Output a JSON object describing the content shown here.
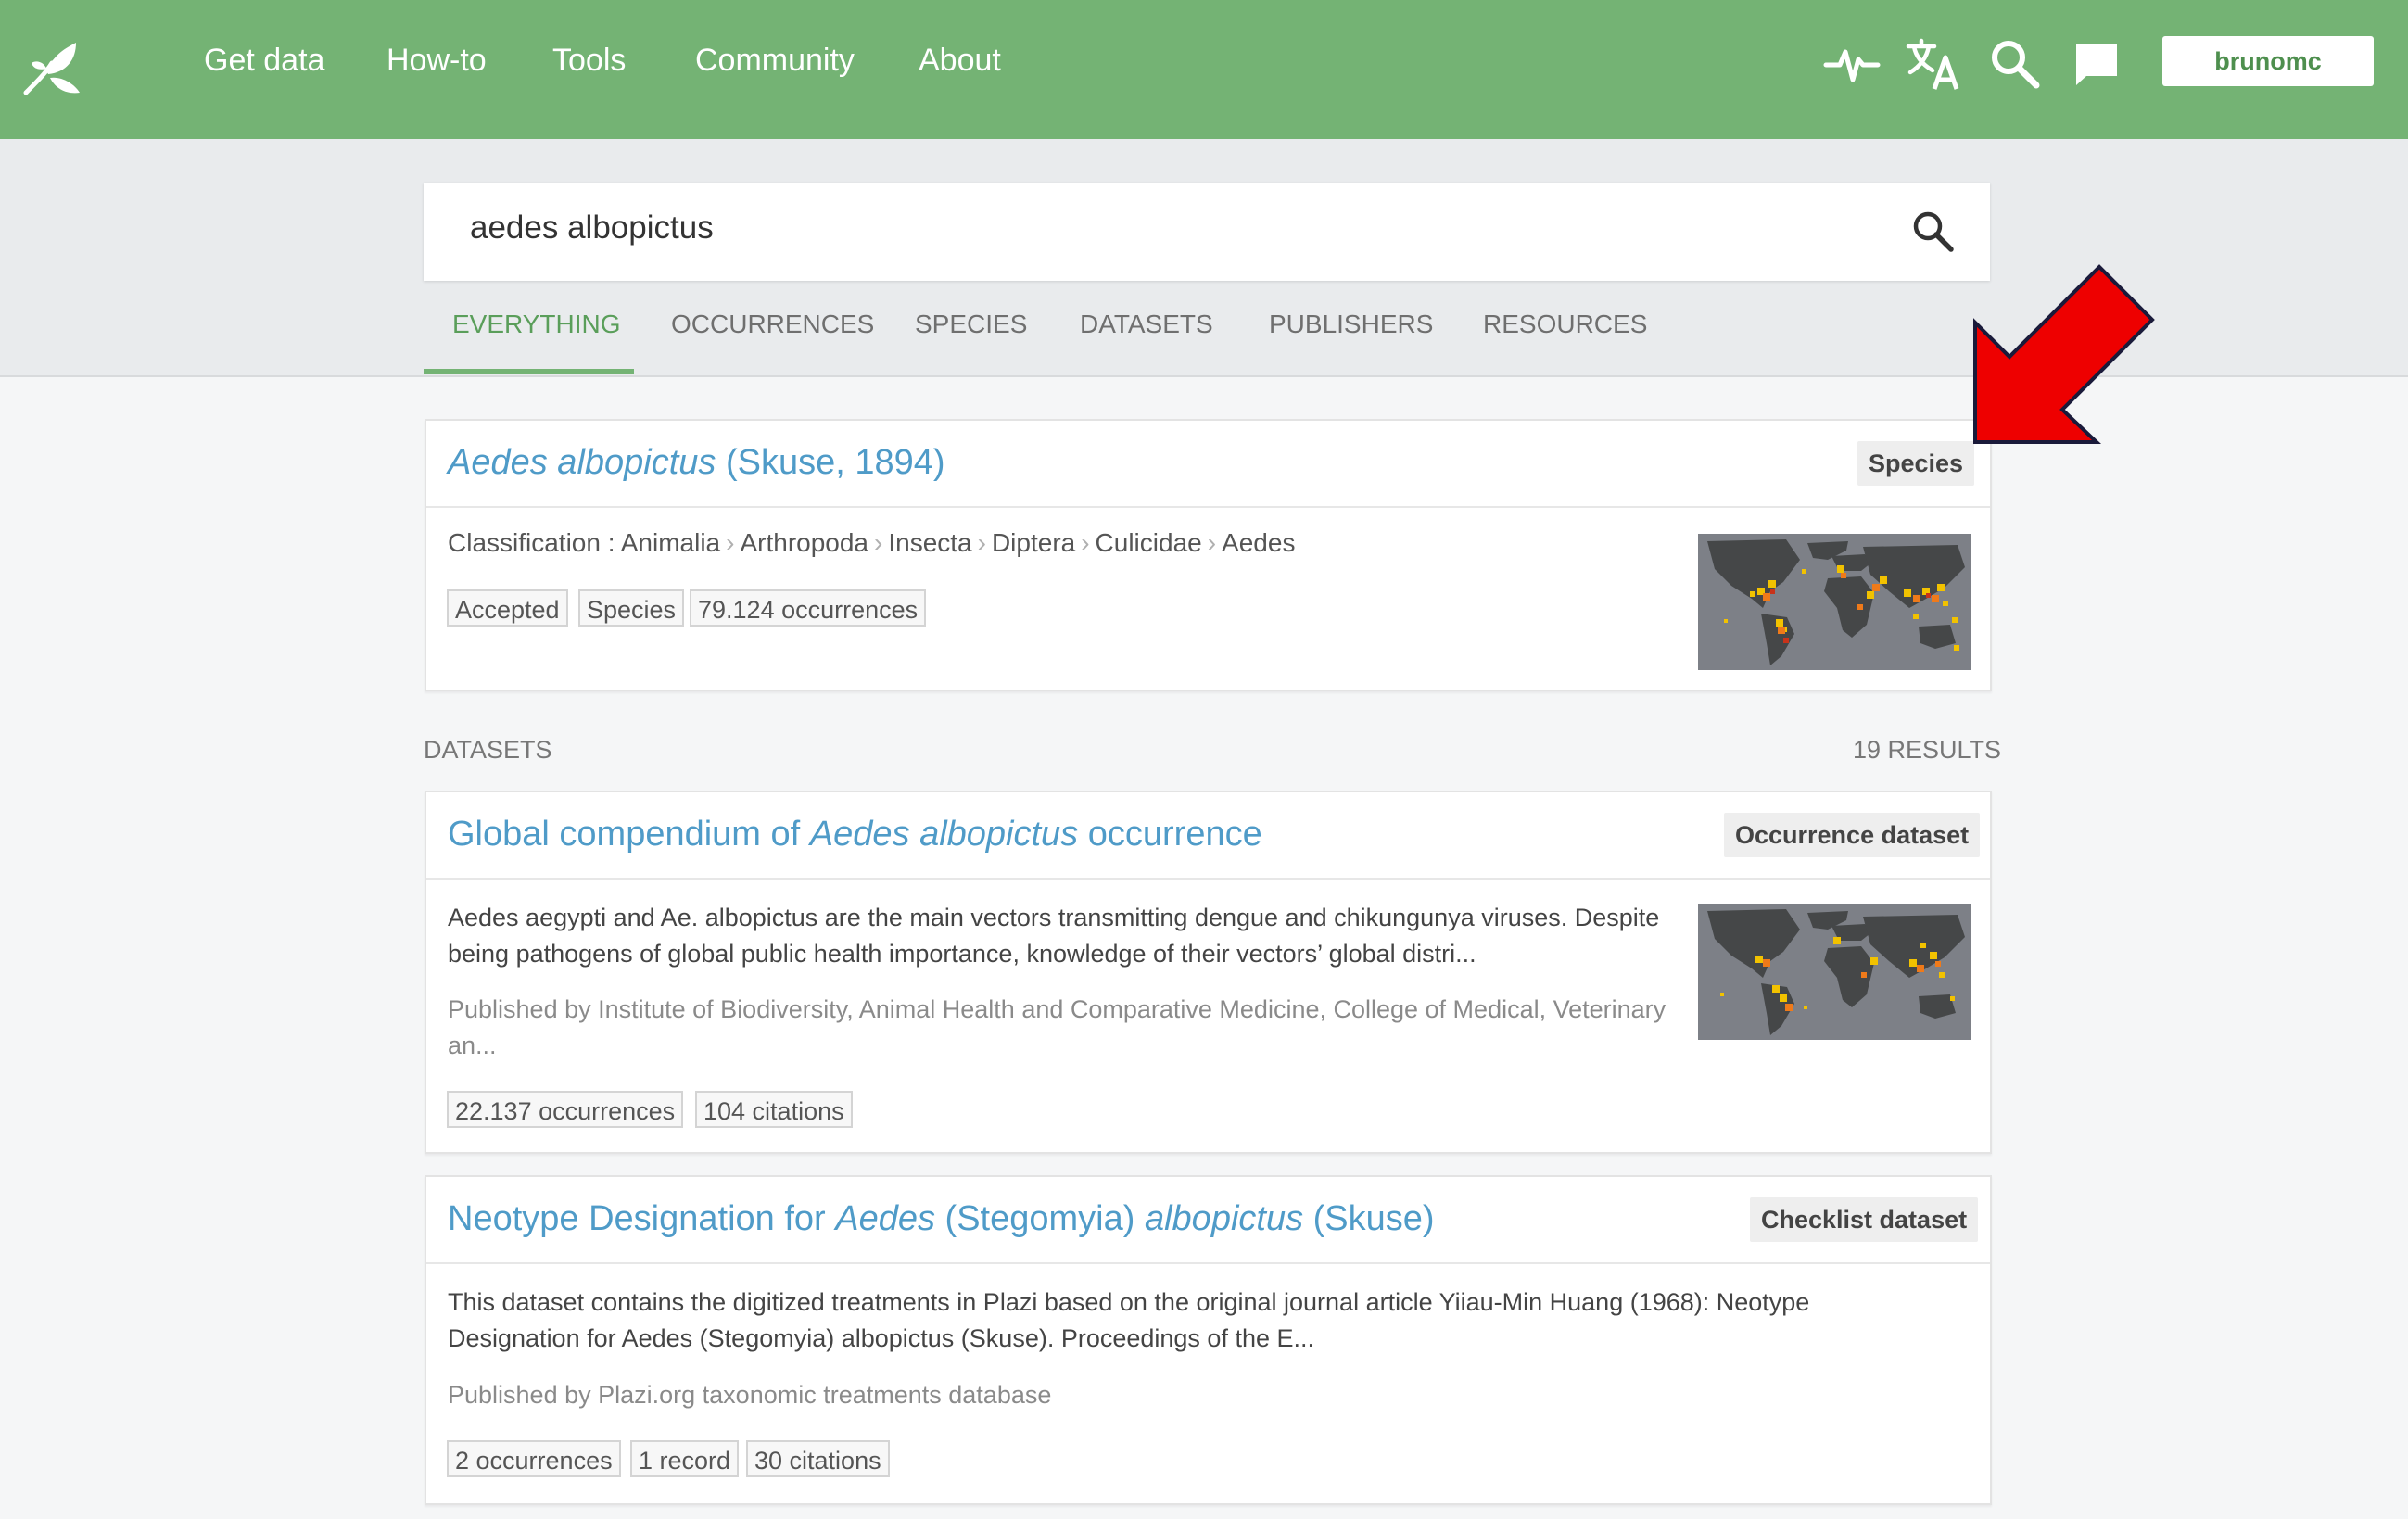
{
  "topbar": {
    "nav": [
      "Get data",
      "How-to",
      "Tools",
      "Community",
      "About"
    ],
    "icons": [
      "activity-icon",
      "translate-icon",
      "search-icon",
      "chat-icon"
    ],
    "user": "brunomc"
  },
  "search": {
    "query": "aedes albopictus"
  },
  "tabs": [
    {
      "label": "EVERYTHING",
      "active": true
    },
    {
      "label": "OCCURRENCES",
      "active": false
    },
    {
      "label": "SPECIES",
      "active": false
    },
    {
      "label": "DATASETS",
      "active": false
    },
    {
      "label": "PUBLISHERS",
      "active": false
    },
    {
      "label": "RESOURCES",
      "active": false
    }
  ],
  "species_card": {
    "title_italic": "Aedes albopictus",
    "title_rest": " (Skuse, 1894)",
    "type": "Species",
    "classification_label": "Classification :",
    "classification": [
      "Animalia",
      "Arthropoda",
      "Insecta",
      "Diptera",
      "Culicidae",
      "Aedes"
    ],
    "chips": [
      "Accepted",
      "Species",
      "79.124 occurrences"
    ]
  },
  "datasets_section": {
    "label": "DATASETS",
    "count": "19 RESULTS"
  },
  "dataset1": {
    "title_pre": "Global compendium of ",
    "title_italic": "Aedes albopictus",
    "title_post": " occurrence",
    "type": "Occurrence dataset",
    "desc_line1": "Aedes aegypti and Ae. albopictus are the main vectors transmitting dengue and chikungunya viruses. Despite",
    "desc_line2": "being pathogens of global public health importance, knowledge of their vectors’ global distri...",
    "pub_line1": "Published by Institute of Biodiversity, Animal Health and Comparative Medicine, College of Medical, Veterinary",
    "pub_line2": "an...",
    "chips": [
      "22.137 occurrences",
      "104 citations"
    ]
  },
  "dataset2": {
    "title_pre": "Neotype Designation for ",
    "title_i1": "Aedes",
    "title_mid": " (Stegomyia) ",
    "title_i2": "albopictus",
    "title_post": " (Skuse)",
    "type": "Checklist dataset",
    "desc_line1": "This dataset contains the digitized treatments in Plazi based on the original journal article Yiiau-Min Huang (1968): Neotype",
    "desc_line2": "Designation for Aedes (Stegomyia) albopictus (Skuse). Proceedings of the E...",
    "pub_line1": "Published by Plazi.org taxonomic treatments database",
    "chips": [
      "2 occurrences",
      "1 record",
      "30 citations"
    ]
  },
  "colors": {
    "brand_green": "#74b374",
    "link_blue": "#4f9bc8",
    "annotation_arrow": "#ee0000"
  }
}
